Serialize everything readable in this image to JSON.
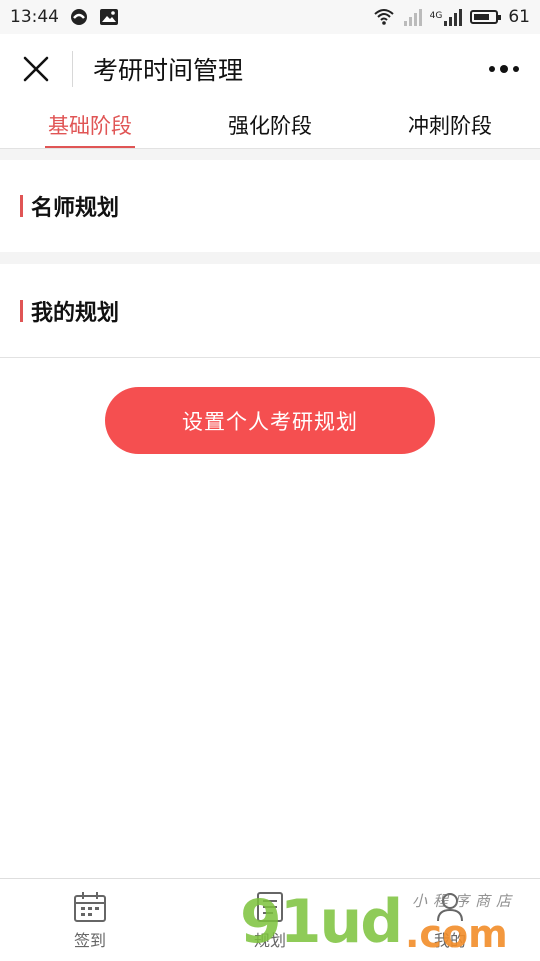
{
  "status_bar": {
    "time": "13:44",
    "battery": "61",
    "network_label": "4G"
  },
  "nav": {
    "title": "考研时间管理"
  },
  "tabs": [
    {
      "label": "基础阶段",
      "active": true
    },
    {
      "label": "强化阶段",
      "active": false
    },
    {
      "label": "冲刺阶段",
      "active": false
    }
  ],
  "sections": {
    "teacher_plan": "名师规划",
    "my_plan": "我的规划"
  },
  "action": {
    "set_plan_label": "设置个人考研规划"
  },
  "bottom_nav": [
    {
      "label": "签到",
      "icon": "calendar-icon"
    },
    {
      "label": "规划",
      "icon": "list-icon"
    },
    {
      "label": "我的",
      "icon": "user-icon"
    }
  ],
  "watermark": {
    "brand": "91ud",
    "suffix": ".com",
    "tagline": "小程序商店"
  },
  "colors": {
    "accent": "#e05555",
    "button": "#f54f50",
    "watermark_green": "#7cc23c",
    "watermark_orange": "#f28d2a"
  }
}
